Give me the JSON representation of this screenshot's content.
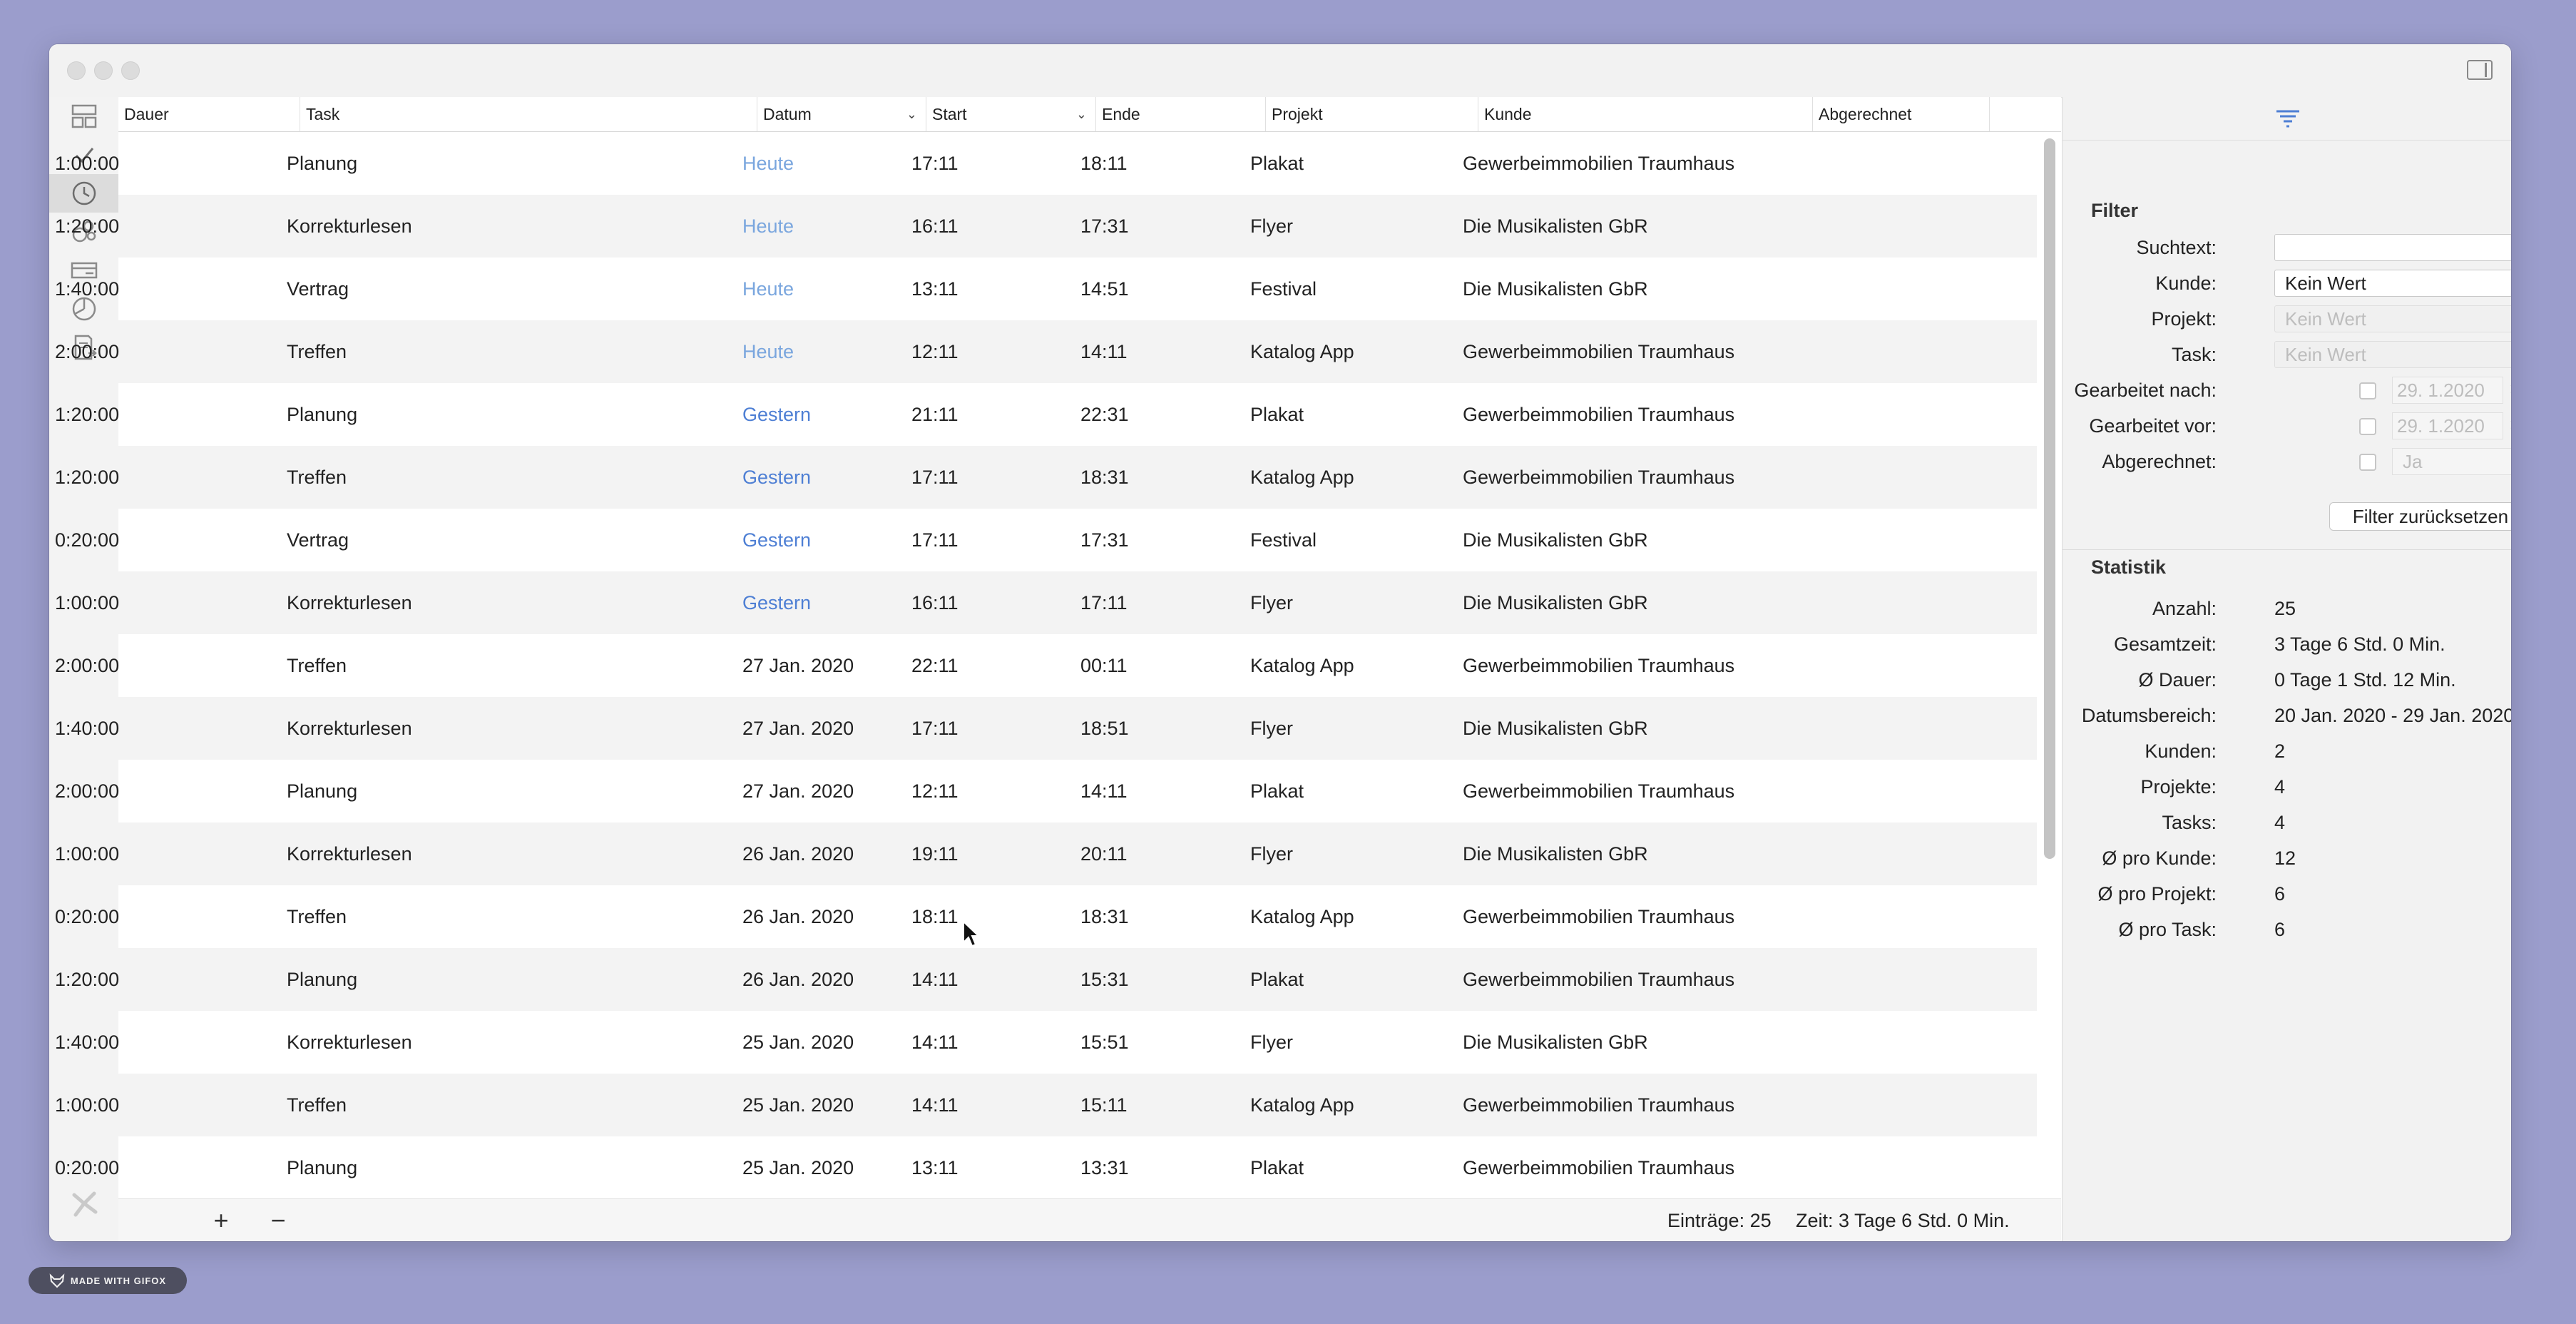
{
  "columns": [
    "Dauer",
    "Task",
    "Datum",
    "Start",
    "Ende",
    "Projekt",
    "Kunde",
    "Abgerechnet"
  ],
  "rows": [
    {
      "dauer": "1:00:00",
      "task": "Planung",
      "datum": "Heute",
      "start": "17:11",
      "ende": "18:11",
      "projekt": "Plakat",
      "kunde": "Gewerbeimmobilien Traumhaus"
    },
    {
      "dauer": "1:20:00",
      "task": "Korrekturlesen",
      "datum": "Heute",
      "start": "16:11",
      "ende": "17:31",
      "projekt": "Flyer",
      "kunde": "Die Musikalisten GbR"
    },
    {
      "dauer": "1:40:00",
      "task": "Vertrag",
      "datum": "Heute",
      "start": "13:11",
      "ende": "14:51",
      "projekt": "Festival",
      "kunde": "Die Musikalisten GbR"
    },
    {
      "dauer": "2:00:00",
      "task": "Treffen",
      "datum": "Heute",
      "start": "12:11",
      "ende": "14:11",
      "projekt": "Katalog App",
      "kunde": "Gewerbeimmobilien Traumhaus"
    },
    {
      "dauer": "1:20:00",
      "task": "Planung",
      "datum": "Gestern",
      "start": "21:11",
      "ende": "22:31",
      "projekt": "Plakat",
      "kunde": "Gewerbeimmobilien Traumhaus"
    },
    {
      "dauer": "1:20:00",
      "task": "Treffen",
      "datum": "Gestern",
      "start": "17:11",
      "ende": "18:31",
      "projekt": "Katalog App",
      "kunde": "Gewerbeimmobilien Traumhaus"
    },
    {
      "dauer": "0:20:00",
      "task": "Vertrag",
      "datum": "Gestern",
      "start": "17:11",
      "ende": "17:31",
      "projekt": "Festival",
      "kunde": "Die Musikalisten GbR"
    },
    {
      "dauer": "1:00:00",
      "task": "Korrekturlesen",
      "datum": "Gestern",
      "start": "16:11",
      "ende": "17:11",
      "projekt": "Flyer",
      "kunde": "Die Musikalisten GbR"
    },
    {
      "dauer": "2:00:00",
      "task": "Treffen",
      "datum": "27 Jan. 2020",
      "start": "22:11",
      "ende": "00:11",
      "projekt": "Katalog App",
      "kunde": "Gewerbeimmobilien Traumhaus"
    },
    {
      "dauer": "1:40:00",
      "task": "Korrekturlesen",
      "datum": "27 Jan. 2020",
      "start": "17:11",
      "ende": "18:51",
      "projekt": "Flyer",
      "kunde": "Die Musikalisten GbR"
    },
    {
      "dauer": "2:00:00",
      "task": "Planung",
      "datum": "27 Jan. 2020",
      "start": "12:11",
      "ende": "14:11",
      "projekt": "Plakat",
      "kunde": "Gewerbeimmobilien Traumhaus"
    },
    {
      "dauer": "1:00:00",
      "task": "Korrekturlesen",
      "datum": "26 Jan. 2020",
      "start": "19:11",
      "ende": "20:11",
      "projekt": "Flyer",
      "kunde": "Die Musikalisten GbR"
    },
    {
      "dauer": "0:20:00",
      "task": "Treffen",
      "datum": "26 Jan. 2020",
      "start": "18:11",
      "ende": "18:31",
      "projekt": "Katalog App",
      "kunde": "Gewerbeimmobilien Traumhaus"
    },
    {
      "dauer": "1:20:00",
      "task": "Planung",
      "datum": "26 Jan. 2020",
      "start": "14:11",
      "ende": "15:31",
      "projekt": "Plakat",
      "kunde": "Gewerbeimmobilien Traumhaus"
    },
    {
      "dauer": "1:40:00",
      "task": "Korrekturlesen",
      "datum": "25 Jan. 2020",
      "start": "14:11",
      "ende": "15:51",
      "projekt": "Flyer",
      "kunde": "Die Musikalisten GbR"
    },
    {
      "dauer": "1:00:00",
      "task": "Treffen",
      "datum": "25 Jan. 2020",
      "start": "14:11",
      "ende": "15:11",
      "projekt": "Katalog App",
      "kunde": "Gewerbeimmobilien Traumhaus"
    },
    {
      "dauer": "0:20:00",
      "task": "Planung",
      "datum": "25 Jan. 2020",
      "start": "13:11",
      "ende": "13:31",
      "projekt": "Plakat",
      "kunde": "Gewerbeimmobilien Traumhaus"
    }
  ],
  "footer": {
    "add_label": "+",
    "remove_label": "−",
    "entries": "Einträge: 25",
    "time": "Zeit: 3 Tage 6 Std. 0 Min."
  },
  "filter": {
    "title": "Filter",
    "search_label": "Suchtext:",
    "search_value": "",
    "kunde_label": "Kunde:",
    "kunde_value": "Kein Wert",
    "projekt_label": "Projekt:",
    "projekt_value": "Kein Wert",
    "task_label": "Task:",
    "task_value": "Kein Wert",
    "after_label": "Gearbeitet nach:",
    "after_value": "29.  1.2020",
    "before_label": "Gearbeitet vor:",
    "before_value": "29.  1.2020",
    "billed_label": "Abgerechnet:",
    "billed_value": "Ja",
    "reset_label": "Filter zurücksetzen"
  },
  "stats": {
    "title": "Statistik",
    "items": [
      {
        "label": "Anzahl:",
        "value": "25"
      },
      {
        "label": "Gesamtzeit:",
        "value": "3 Tage 6 Std. 0 Min."
      },
      {
        "label": "Ø Dauer:",
        "value": "0 Tage 1 Std. 12 Min."
      },
      {
        "label": "Datumsbereich:",
        "value": "20 Jan. 2020 - 29 Jan. 2020"
      },
      {
        "label": "Kunden:",
        "value": "2"
      },
      {
        "label": "Projekte:",
        "value": "4"
      },
      {
        "label": "Tasks:",
        "value": "4"
      },
      {
        "label": "Ø pro Kunde:",
        "value": "12"
      },
      {
        "label": "Ø pro Projekt:",
        "value": "6"
      },
      {
        "label": "Ø pro Task:",
        "value": "6"
      }
    ]
  },
  "badge": {
    "text": "MADE WITH GIFOX"
  },
  "colors": {
    "background": "#9b9dcc",
    "relative_date": "#4e7fd4",
    "accent": "#4e7fd4"
  },
  "icons": [
    "dashboard-icon",
    "checkmark-icon",
    "clock-icon",
    "clients-icon",
    "invoice-icon",
    "chart-icon",
    "export-icon",
    "app-logo-icon",
    "filter-icon",
    "sidebar-toggle-icon"
  ]
}
